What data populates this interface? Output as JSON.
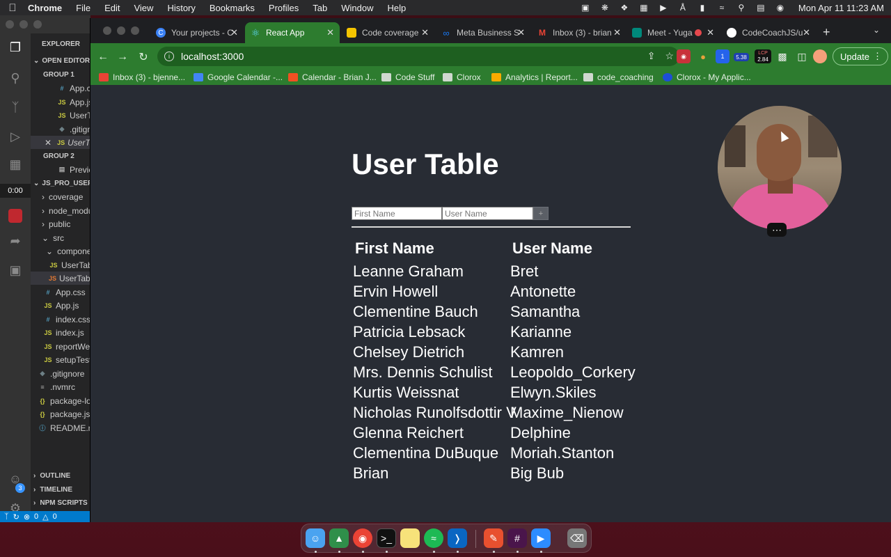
{
  "menubar": {
    "app_name": "Chrome",
    "items": [
      "File",
      "Edit",
      "View",
      "History",
      "Bookmarks",
      "Profiles",
      "Tab",
      "Window",
      "Help"
    ],
    "clock": "Mon Apr 11  11:23 AM"
  },
  "vscode": {
    "explorer_title": "EXPLORER",
    "open_editors": "OPEN EDITORS",
    "group1": "GROUP 1",
    "group1_files": [
      "App.css",
      "App.js",
      "UserTable",
      ".gitignore",
      "UserTable"
    ],
    "group2": "GROUP 2",
    "group2_files": [
      "Preview"
    ],
    "project": "JS_PRO_USER",
    "tree": [
      "coverage",
      "node_modules",
      "public",
      "src",
      "components",
      "UserTable",
      "UserTable",
      "App.css",
      "App.js",
      "index.css",
      "index.js",
      "reportWebVitals",
      "setupTests",
      ".gitignore",
      ".nvmrc",
      "package-lock",
      "package.json",
      "README.md"
    ],
    "outline": "OUTLINE",
    "timeline": "TIMELINE",
    "npm_scripts": "NPM SCRIPTS",
    "timer": "0:00",
    "badge": "3",
    "status_errors": "0",
    "status_warnings": "0"
  },
  "browser": {
    "tabs": [
      {
        "label": "Your projects - C",
        "favicon": "codesandbox-icon",
        "color": "#3b82f6"
      },
      {
        "label": "React App",
        "favicon": "react-icon",
        "color": "#61dafb",
        "active": true
      },
      {
        "label": "Code coverage",
        "favicon": "coverage-icon",
        "color": "#f5c400"
      },
      {
        "label": "Meta Business S",
        "favicon": "meta-icon",
        "color": "#1877f2"
      },
      {
        "label": "Inbox (3) - brian",
        "favicon": "gmail-icon",
        "color": "#ea4335"
      },
      {
        "label": "Meet - Yuga",
        "favicon": "meet-icon",
        "color": "#00897b"
      },
      {
        "label": "CodeCoachJS/u",
        "favicon": "github-icon",
        "color": "#ffffff"
      }
    ],
    "url": "localhost:3000",
    "update_label": "Update",
    "ext_badge_1": "1",
    "ext_badge_2": "5.38",
    "ext_badge_3": "2.84",
    "ext_lcp": "LCP",
    "bookmarks": [
      "Inbox (3) - bjenne...",
      "Google Calendar -...",
      "Calendar - Brian J...",
      "Code Stuff",
      "Clorox",
      "Analytics | Report...",
      "code_coaching",
      "Clorox - My Applic..."
    ]
  },
  "app": {
    "title": "User Table",
    "first_name_placeholder": "First Name",
    "user_name_placeholder": "User Name",
    "add_label": "+",
    "columns": [
      "First Name",
      "User Name"
    ],
    "rows": [
      {
        "first": "Leanne Graham",
        "user": "Bret"
      },
      {
        "first": "Ervin Howell",
        "user": "Antonette"
      },
      {
        "first": "Clementine Bauch",
        "user": "Samantha"
      },
      {
        "first": "Patricia Lebsack",
        "user": "Karianne"
      },
      {
        "first": "Chelsey Dietrich",
        "user": "Kamren"
      },
      {
        "first": "Mrs. Dennis Schulist",
        "user": "Leopoldo_Corkery"
      },
      {
        "first": "Kurtis Weissnat",
        "user": "Elwyn.Skiles"
      },
      {
        "first": "Nicholas Runolfsdottir V",
        "user": "Maxime_Nienow"
      },
      {
        "first": "Glenna Reichert",
        "user": "Delphine"
      },
      {
        "first": "Clementina DuBuque",
        "user": "Moriah.Stanton"
      },
      {
        "first": "Brian",
        "user": "Big Bub"
      }
    ]
  },
  "dock": [
    "finder",
    "sourcetree",
    "chrome",
    "terminal",
    "notes",
    "spotify",
    "vscode",
    "pencil",
    "slack",
    "zoom",
    "trash"
  ]
}
